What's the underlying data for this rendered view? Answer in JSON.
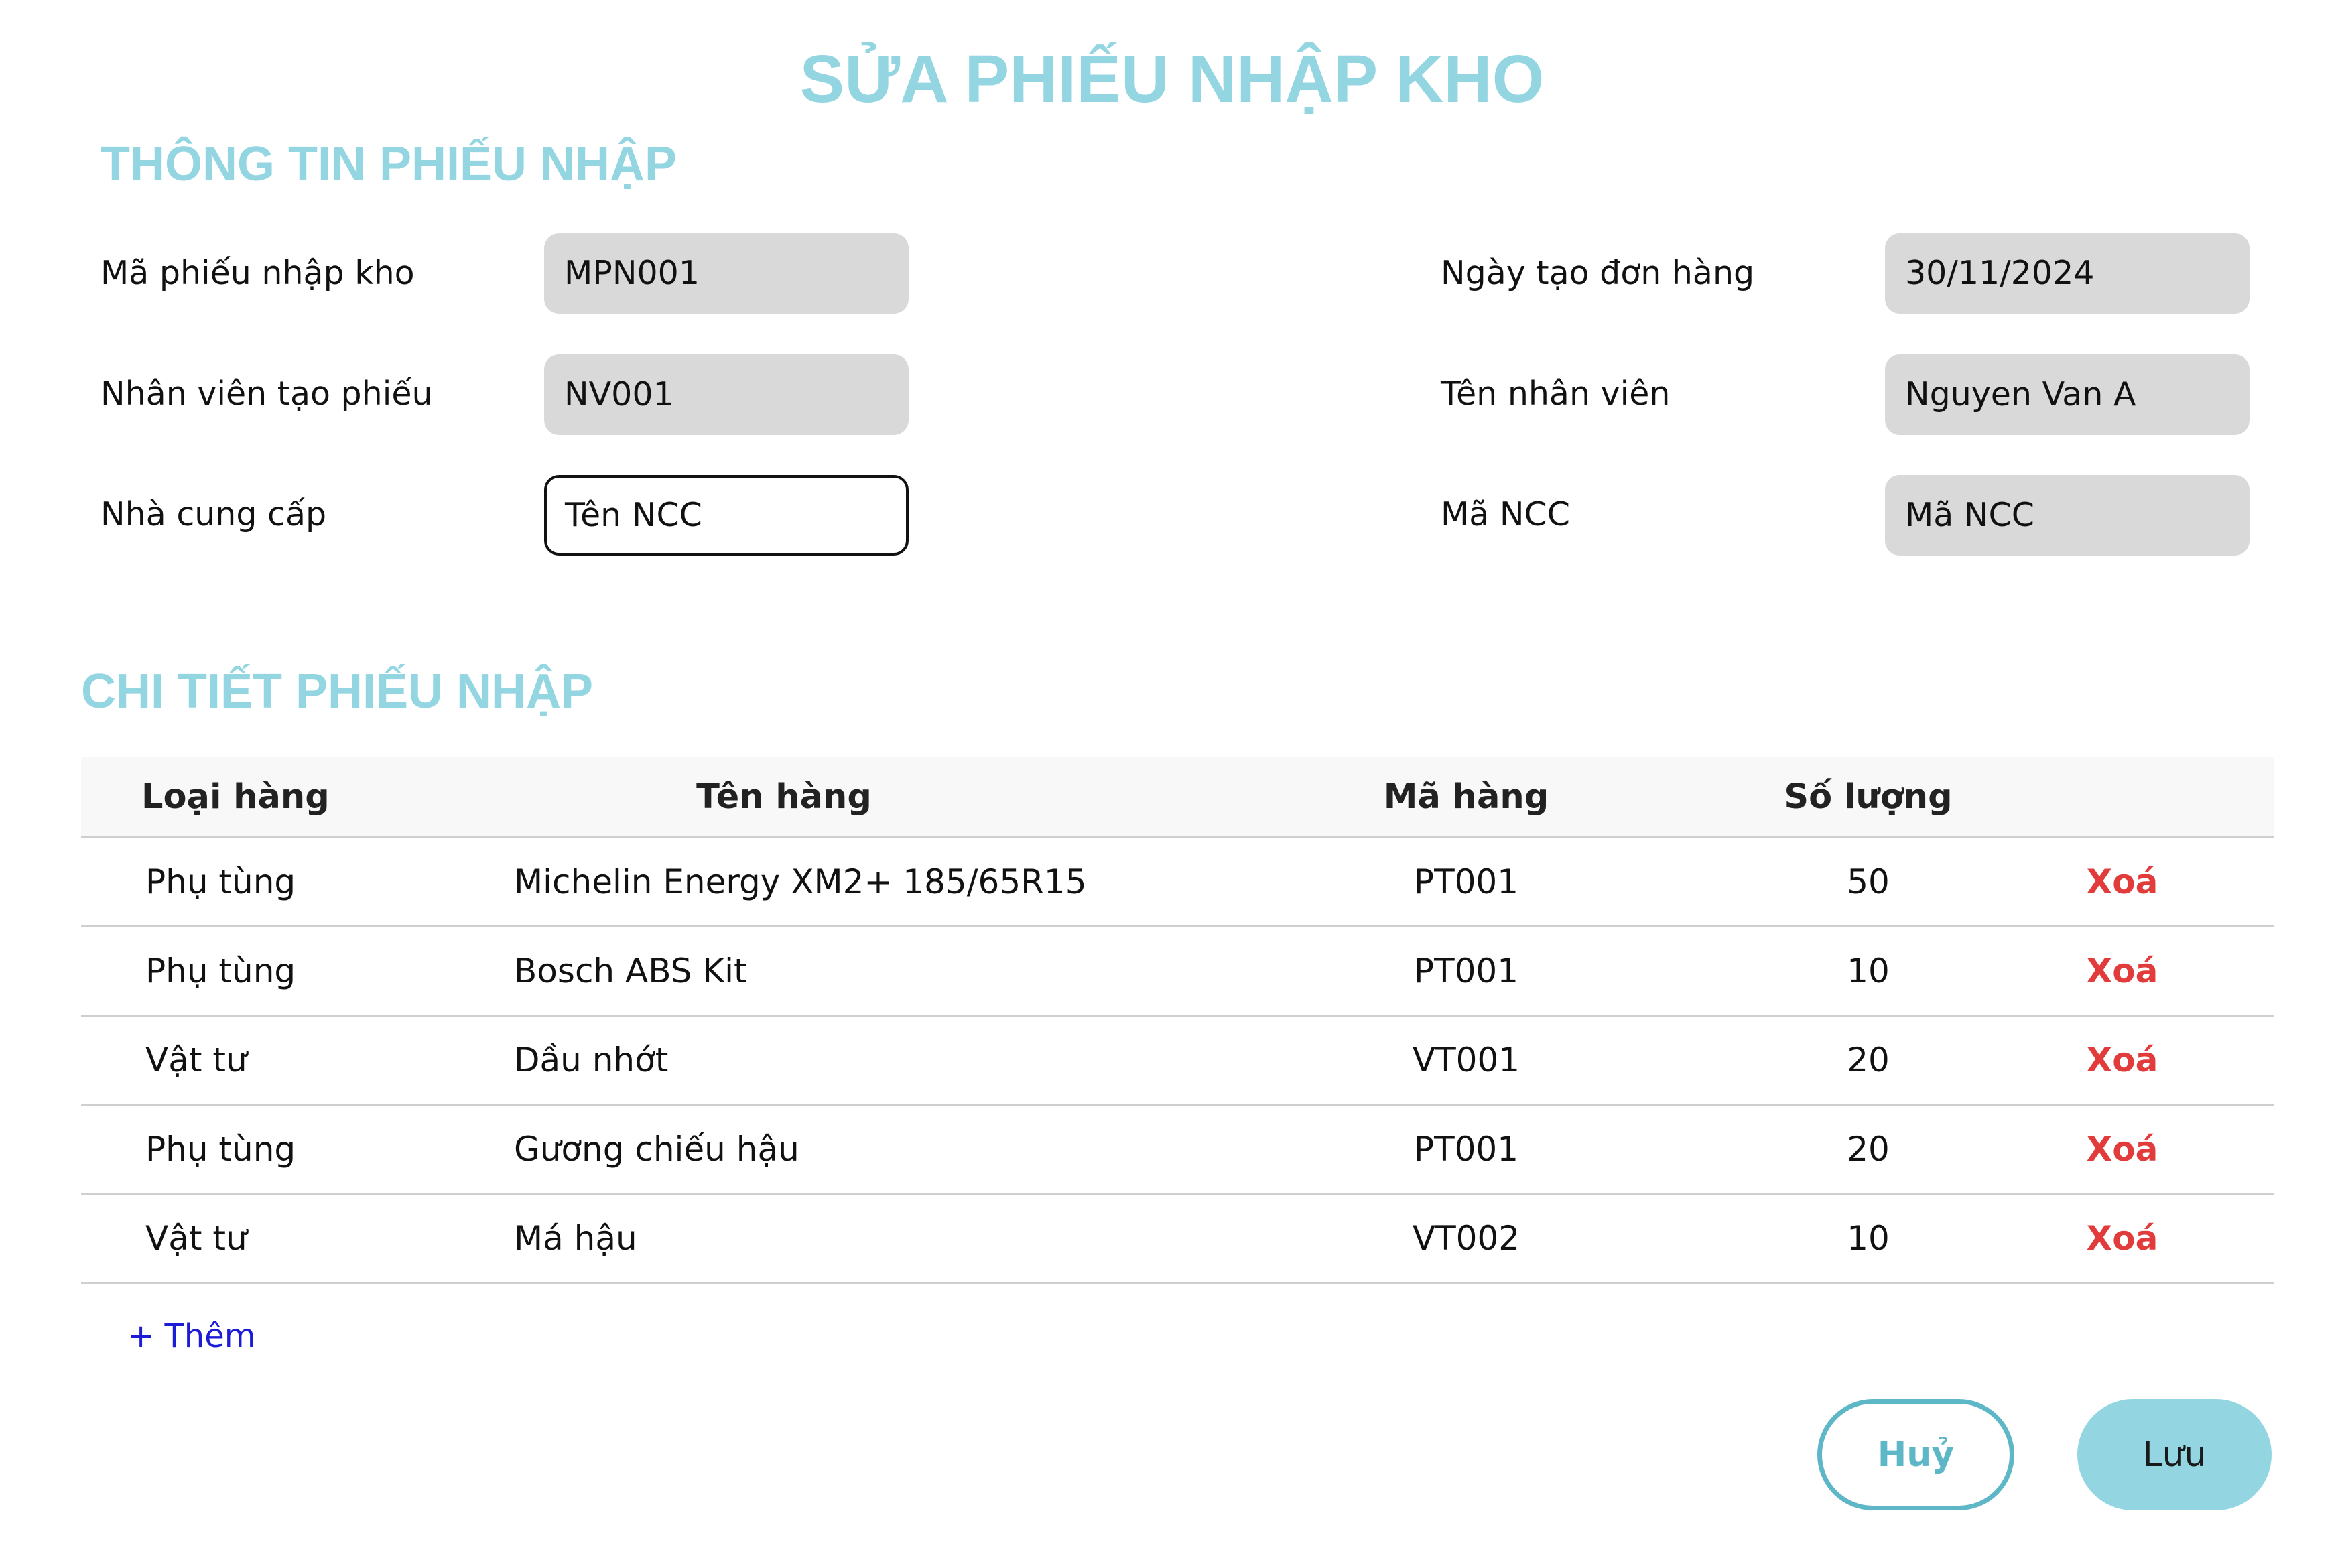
{
  "colors": {
    "accent": "#93d6e1",
    "cancel_outline": "#5eb7c6",
    "delete_red": "#e23b3b",
    "link_blue": "#1c1cd6",
    "readonly_field": "#d9d9d9"
  },
  "page": {
    "title": "SỬA PHIẾU NHẬP KHO"
  },
  "info": {
    "section_title": "THÔNG TIN PHIẾU NHẬP",
    "receipt_code": {
      "label": "Mã phiếu nhập kho",
      "value": "MPN001"
    },
    "created_date": {
      "label": "Ngày tạo đơn hàng",
      "value": "30/11/2024"
    },
    "employee_id": {
      "label": "Nhân viên tạo phiếu",
      "value": "NV001"
    },
    "employee_name": {
      "label": "Tên nhân viên",
      "value": "Nguyen Van A"
    },
    "supplier": {
      "label": "Nhà cung cấp",
      "value": "Tên NCC"
    },
    "supplier_code": {
      "label": "Mã NCC",
      "value": "Mã NCC"
    }
  },
  "details": {
    "section_title": "CHI TIẾT PHIẾU NHẬP",
    "columns": [
      "Loại hàng",
      "Tên hàng",
      "Mã hàng",
      "Số lượng"
    ],
    "rows": [
      {
        "type": "Phụ tùng",
        "name": "Michelin Energy XM2+ 185/65R15",
        "code": "PT001",
        "qty": "50",
        "action": "Xoá"
      },
      {
        "type": "Phụ tùng",
        "name": "Bosch ABS Kit",
        "code": "PT001",
        "qty": "10",
        "action": "Xoá"
      },
      {
        "type": "Vật tư",
        "name": "Dầu nhớt",
        "code": "VT001",
        "qty": "20",
        "action": "Xoá"
      },
      {
        "type": "Phụ tùng",
        "name": "Gương chiếu hậu",
        "code": "PT001",
        "qty": "20",
        "action": "Xoá"
      },
      {
        "type": "Vật tư",
        "name": "Má hậu",
        "code": "VT002",
        "qty": "10",
        "action": "Xoá"
      }
    ],
    "add_label": "+ Thêm"
  },
  "actions": {
    "cancel_label": "Huỷ",
    "save_label": "Lưu"
  }
}
